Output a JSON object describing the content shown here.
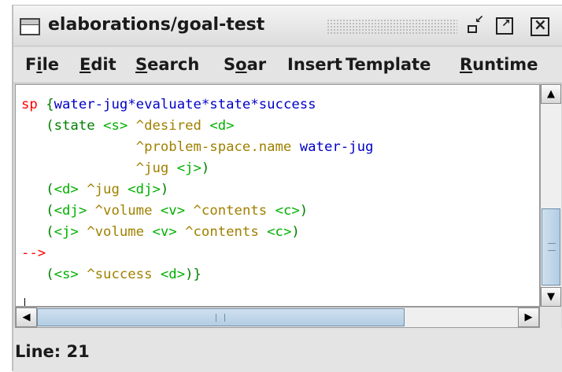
{
  "window": {
    "title": "elaborations/goal-test"
  },
  "menubar": {
    "items": [
      {
        "prefix": "F",
        "key": "i",
        "rest": "le"
      },
      {
        "prefix": "",
        "key": "E",
        "rest": "dit"
      },
      {
        "prefix": "",
        "key": "S",
        "rest": "earch"
      },
      {
        "prefix": "S",
        "key": "o",
        "rest": "ar"
      },
      {
        "prefix": "",
        "key": "",
        "rest": "Insert"
      },
      {
        "prefix": "",
        "key": "",
        "rest": "Template"
      },
      {
        "prefix": "",
        "key": "R",
        "rest": "untime"
      }
    ]
  },
  "editor": {
    "code": [
      [
        {
          "t": "sp ",
          "c": "kw"
        },
        {
          "t": "{",
          "c": "par"
        },
        {
          "t": "water-jug*evaluate*state*success",
          "c": "name"
        }
      ],
      [
        {
          "t": "   (",
          "c": "par"
        },
        {
          "t": "state ",
          "c": "par"
        },
        {
          "t": "<s>",
          "c": "var"
        },
        {
          "t": " ^desired ",
          "c": "attr"
        },
        {
          "t": "<d>",
          "c": "var"
        }
      ],
      [
        {
          "t": "              ^problem-space.name ",
          "c": "attr"
        },
        {
          "t": "water-jug",
          "c": "val"
        }
      ],
      [
        {
          "t": "              ^jug ",
          "c": "attr"
        },
        {
          "t": "<j>",
          "c": "var"
        },
        {
          "t": ")",
          "c": "par"
        }
      ],
      [
        {
          "t": "   (",
          "c": "par"
        },
        {
          "t": "<d>",
          "c": "var"
        },
        {
          "t": " ^jug ",
          "c": "attr"
        },
        {
          "t": "<dj>",
          "c": "var"
        },
        {
          "t": ")",
          "c": "par"
        }
      ],
      [
        {
          "t": "   (",
          "c": "par"
        },
        {
          "t": "<dj>",
          "c": "var"
        },
        {
          "t": " ^volume ",
          "c": "attr"
        },
        {
          "t": "<v>",
          "c": "var"
        },
        {
          "t": " ^contents ",
          "c": "attr"
        },
        {
          "t": "<c>",
          "c": "var"
        },
        {
          "t": ")",
          "c": "par"
        }
      ],
      [
        {
          "t": "   (",
          "c": "par"
        },
        {
          "t": "<j>",
          "c": "var"
        },
        {
          "t": " ^volume ",
          "c": "attr"
        },
        {
          "t": "<v>",
          "c": "var"
        },
        {
          "t": " ^contents ",
          "c": "attr"
        },
        {
          "t": "<c>",
          "c": "var"
        },
        {
          "t": ")",
          "c": "par"
        }
      ],
      [
        {
          "t": "-->",
          "c": "arrow"
        }
      ],
      [
        {
          "t": "   (",
          "c": "par"
        },
        {
          "t": "<s>",
          "c": "var"
        },
        {
          "t": " ^success ",
          "c": "attr"
        },
        {
          "t": "<d>",
          "c": "var"
        },
        {
          "t": ")}",
          "c": "par"
        }
      ]
    ]
  },
  "status": {
    "text": "Line: 21"
  },
  "colors": {
    "keyword": "#ff0000",
    "production_name": "#0000c8",
    "paren": "#008000",
    "variable": "#00b000",
    "attribute": "#a08000",
    "value": "#0000c8",
    "scrollbar_thumb": "#b3cde3"
  },
  "icons": {
    "window": "window-icon",
    "minimize": "minimize-icon",
    "maximize": "maximize-icon",
    "close": "close-icon",
    "scroll_up": "arrow-up-icon",
    "scroll_down": "arrow-down-icon",
    "scroll_left": "arrow-left-icon",
    "scroll_right": "arrow-right-icon"
  }
}
